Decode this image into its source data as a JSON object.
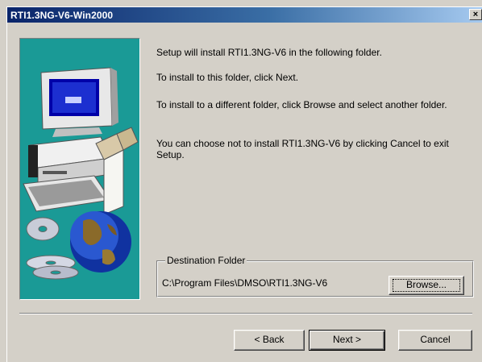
{
  "window": {
    "title": "RTI1.3NG-V6-Win2000",
    "close_glyph": "×"
  },
  "messages": {
    "line1": "Setup will install RTI1.3NG-V6 in the following folder.",
    "line2": "To install to this folder, click Next.",
    "line3": "To install to a different folder, click Browse and select another folder.",
    "line4": "You can choose not to install RTI1.3NG-V6 by clicking Cancel to exit Setup."
  },
  "destination": {
    "legend": "Destination Folder",
    "path": "C:\\Program Files\\DMSO\\RTI1.3NG-V6",
    "browse_label": "Browse..."
  },
  "buttons": {
    "back_label": "< Back",
    "next_label": "Next >",
    "cancel_label": "Cancel"
  },
  "icons": {
    "artwork": "computer-globe-cd-illustration"
  },
  "colors": {
    "title_start": "#0a246a",
    "title_end": "#a6caf0",
    "art_bg": "#1a9a96",
    "dialog_bg": "#d4d0c8"
  }
}
